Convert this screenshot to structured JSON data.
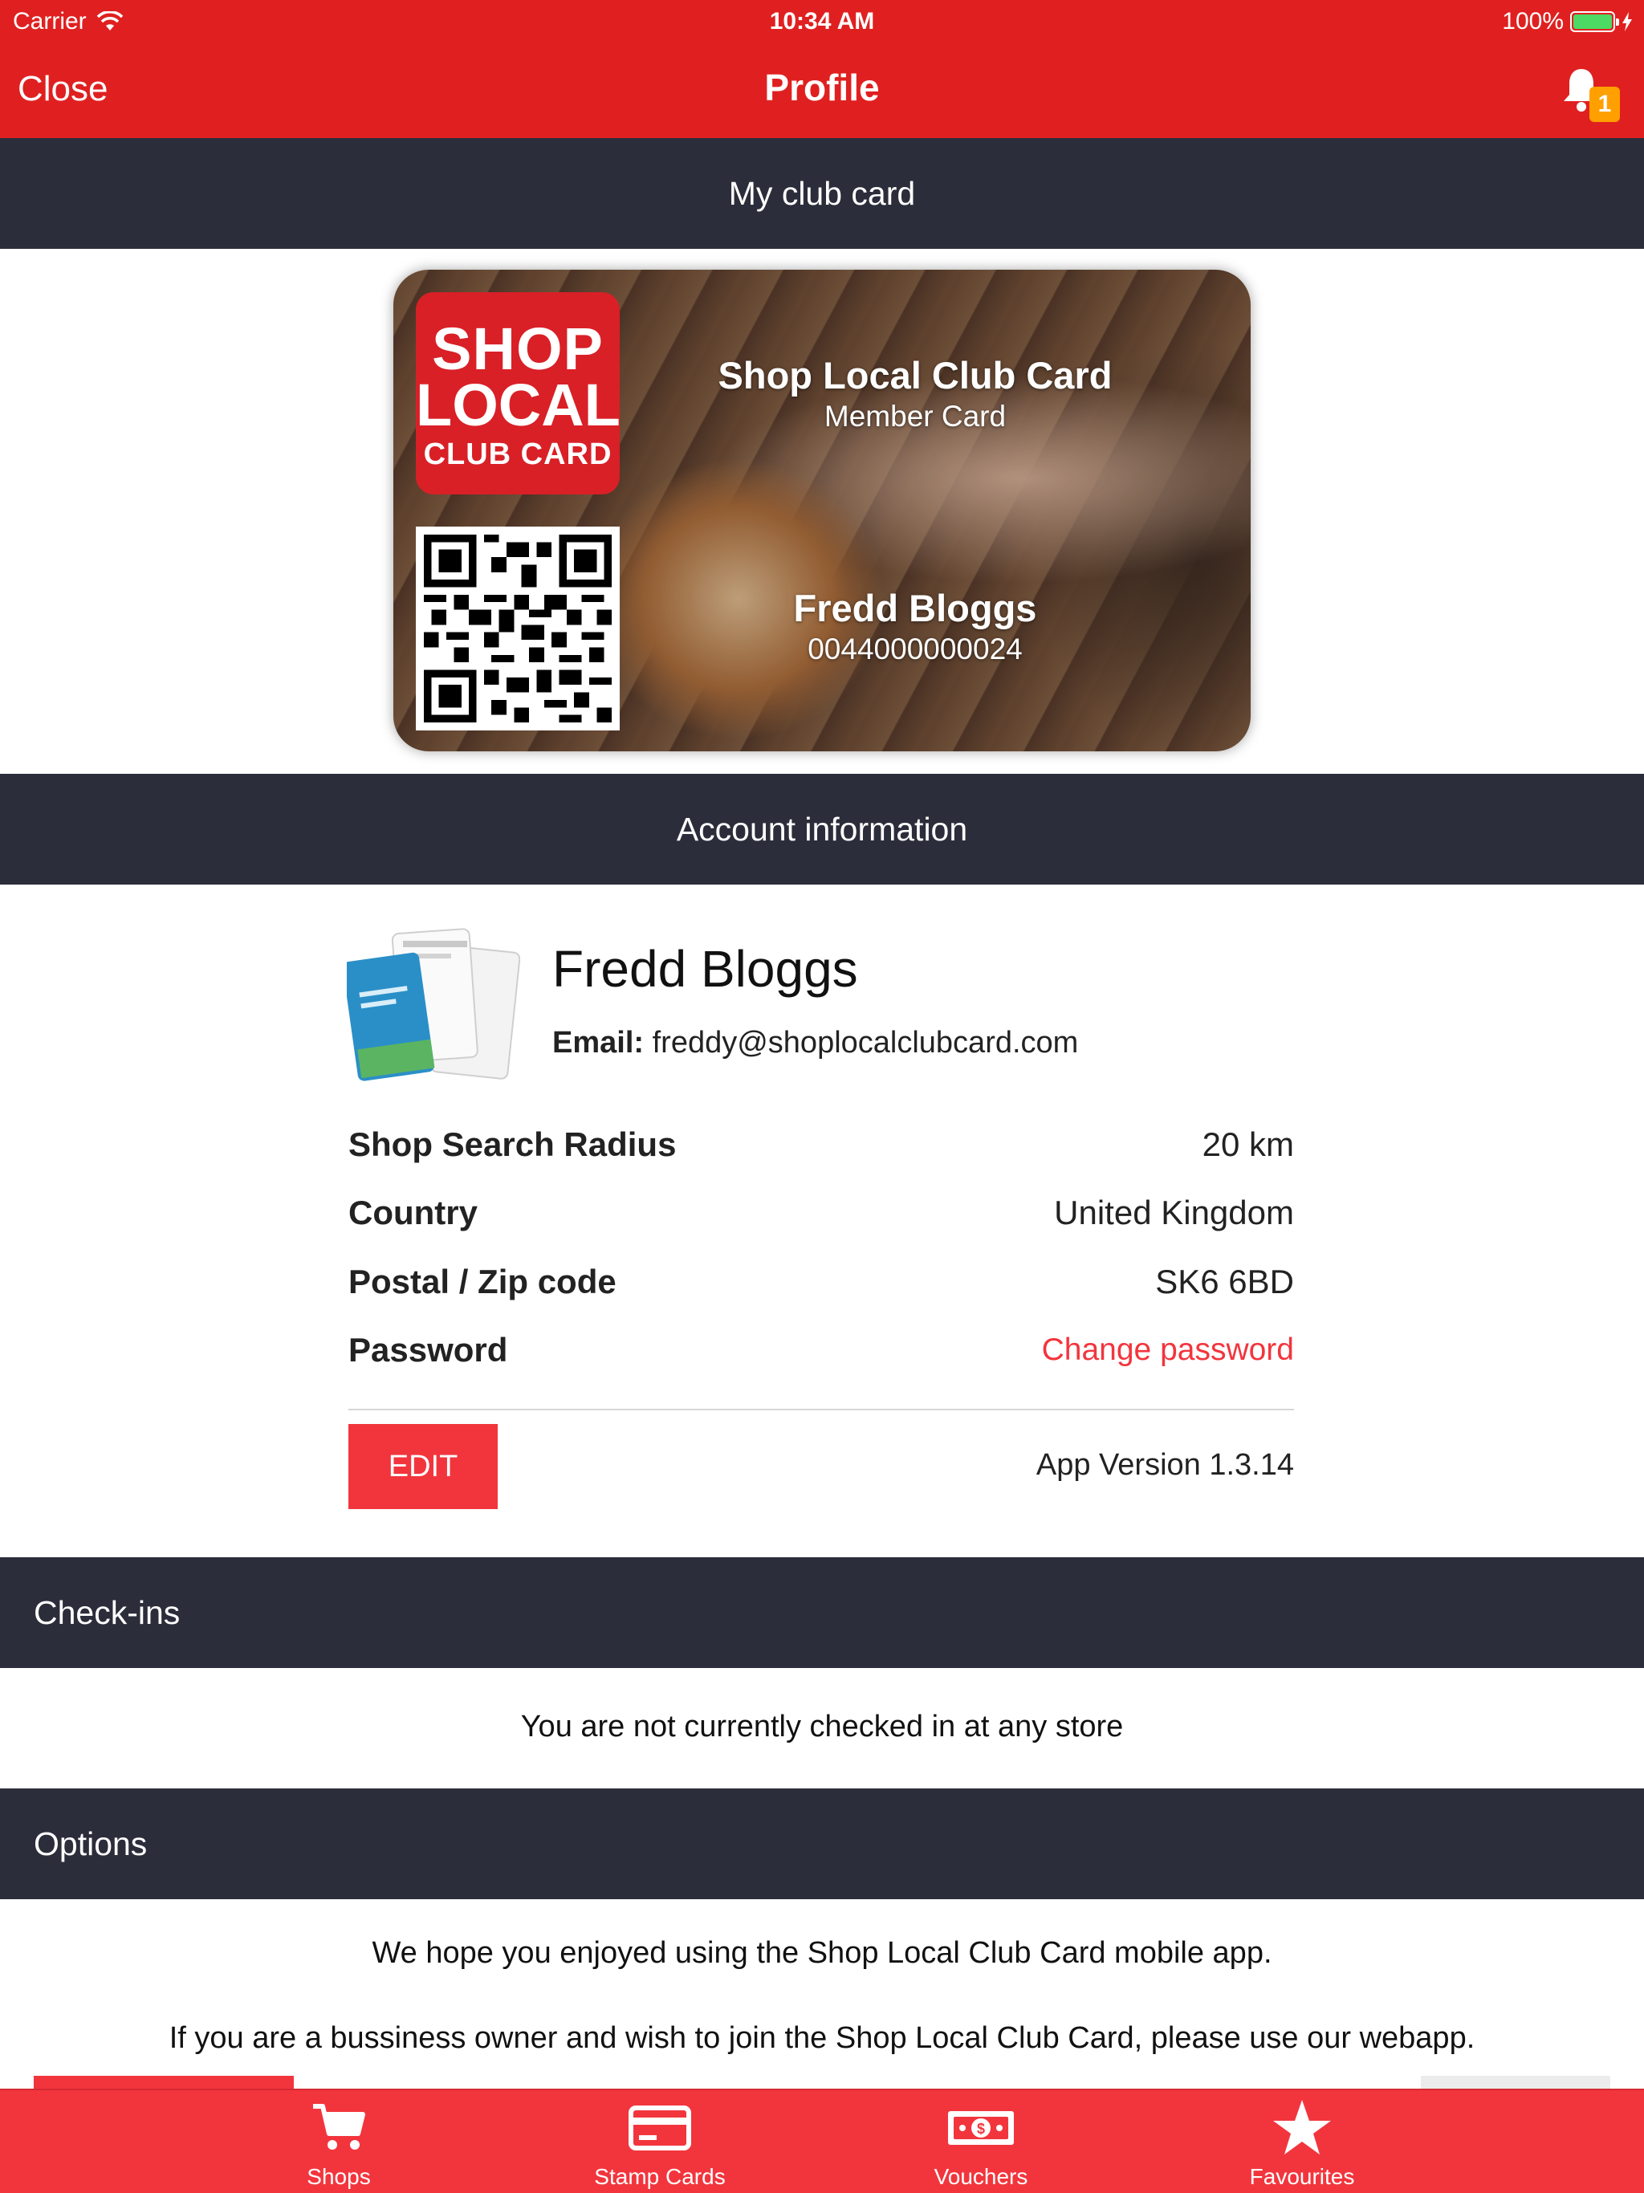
{
  "status_bar": {
    "carrier": "Carrier",
    "time": "10:34 AM",
    "battery": "100%"
  },
  "nav": {
    "close_label": "Close",
    "title": "Profile",
    "notification_count": "1"
  },
  "club_card_section": {
    "header": "My club card",
    "logo_lines": [
      "SHOP",
      "LOCAL",
      "CLUB CARD"
    ],
    "card_title": "Shop Local Club Card",
    "card_subtitle": "Member Card",
    "member_name": "Fredd Bloggs",
    "member_number": "0044000000024"
  },
  "account_section": {
    "header": "Account information",
    "name": "Fredd Bloggs",
    "email_label": "Email:",
    "email": "freddy@shoplocalclubcard.com",
    "rows": [
      {
        "label": "Shop Search Radius",
        "value": "20 km"
      },
      {
        "label": "Country",
        "value": "United Kingdom"
      },
      {
        "label": "Postal / Zip code",
        "value": "SK6 6BD"
      },
      {
        "label": "Password",
        "value": "Change password"
      }
    ],
    "edit_label": "EDIT",
    "app_version": "App Version 1.3.14"
  },
  "checkins_section": {
    "header": "Check-ins",
    "message": "You are not currently checked in at any store"
  },
  "options_section": {
    "header": "Options",
    "line1": "We hope you enjoyed using the Shop Local Club Card mobile app.",
    "line2": "If you are a bussiness owner and wish to join the Shop Local Club Card, please use our webapp."
  },
  "tabbar": {
    "tabs": [
      {
        "label": "Shops",
        "icon": "cart-icon"
      },
      {
        "label": "Stamp Cards",
        "icon": "card-icon"
      },
      {
        "label": "Vouchers",
        "icon": "money-icon"
      },
      {
        "label": "Favourites",
        "icon": "star-icon"
      }
    ]
  },
  "colors": {
    "nav_red": "#e02020",
    "accent_red": "#f2353d",
    "section_header": "#2c2d3a",
    "badge_orange": "#ffa000",
    "battery_green": "#4cd964"
  }
}
